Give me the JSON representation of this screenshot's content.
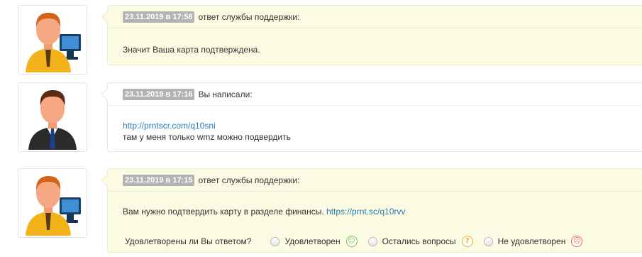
{
  "messages": [
    {
      "date": "23.11.2019 в 17:58",
      "author": "ответ службы поддержки:",
      "text": "Значит Ваша карта подтверждена.",
      "avatar": "support-avatar-icon"
    },
    {
      "date": "23.11.2019 в 17:16",
      "author": "Вы написали:",
      "link": "http://prntscr.com/q10sni",
      "text": "там у меня только wmz можно подвердить",
      "avatar": "user-avatar-icon"
    },
    {
      "date": "23.11.2019 в 17:15",
      "author": "ответ службы поддержки:",
      "text": "Вам нужно подтвердить карту в разделе финансы.",
      "link": "https://prnt.sc/q10rvv",
      "avatar": "support-avatar-icon"
    }
  ],
  "rating": {
    "question": "Удовлетворены ли Вы ответом?",
    "options": [
      {
        "label": "Удовлетворен",
        "icon": "smile-icon",
        "color": "#7cc242"
      },
      {
        "label": "Остались вопросы",
        "icon": "question-icon",
        "color": "#f0ad1e"
      },
      {
        "label": "Не удовлетворен",
        "icon": "sad-icon",
        "color": "#e8694c"
      }
    ]
  },
  "colors": {
    "support_bg": "#fbfbe3",
    "badge_bg": "#b3b3b3",
    "link": "#2a7ab3"
  }
}
